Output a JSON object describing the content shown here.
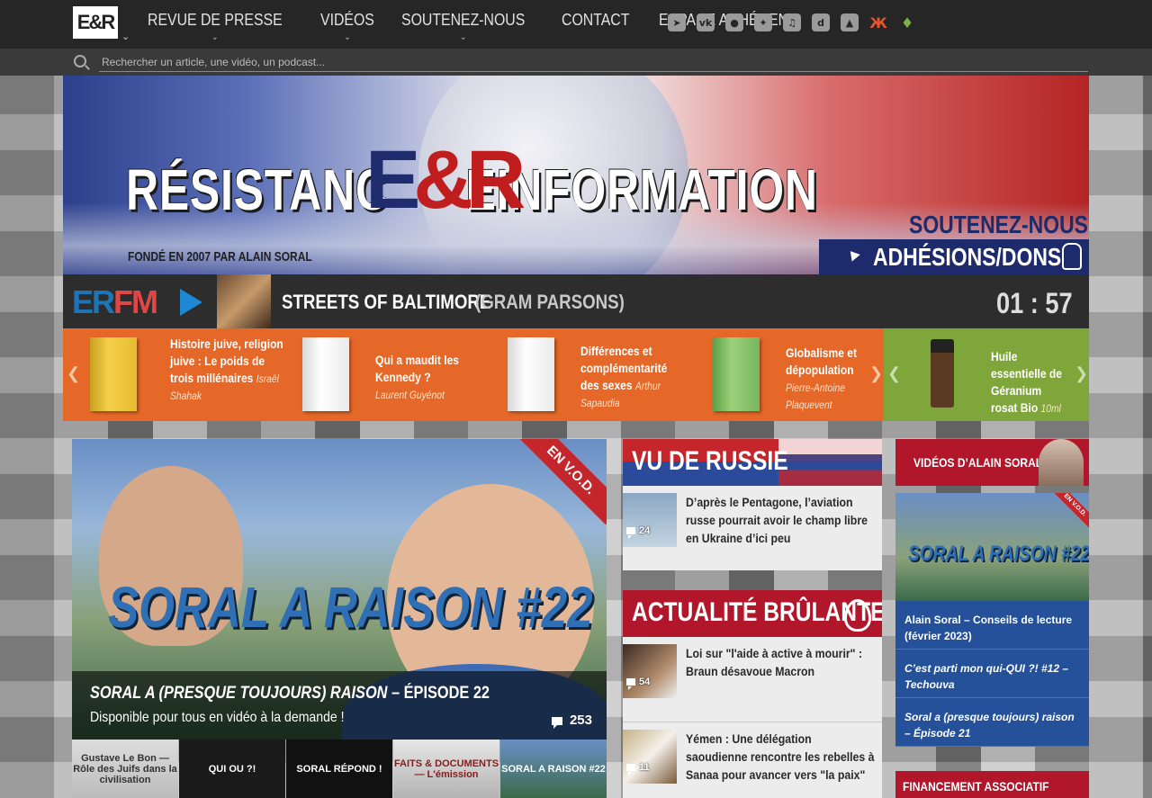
{
  "nav": {
    "logo": "E&R",
    "items": [
      {
        "label": "REVUE DE PRESSE",
        "has_dropdown": true
      },
      {
        "label": "VIDÉOS",
        "has_dropdown": true
      },
      {
        "label": "SOUTENEZ-NOUS",
        "has_dropdown": true
      },
      {
        "label": "CONTACT",
        "has_dropdown": false
      },
      {
        "label": "ESPACE ADHÉRENT",
        "has_dropdown": false
      }
    ],
    "socials": [
      "telegram-icon",
      "vk-icon",
      "odysee-icon",
      "gab-icon",
      "tiktok-icon",
      "dlive-icon",
      "brave-icon",
      "livejournal-icon",
      "rumble-icon"
    ]
  },
  "search": {
    "placeholder": "Rechercher un article, une vidéo, un podcast..."
  },
  "banner": {
    "title": "RÉSISTANC",
    "title_end": "EINFORMATION",
    "er": "E&R",
    "subtitle": "FONDÉ EN 2007 PAR ALAIN SORAL",
    "support": "SOUTENEZ-NOUS !",
    "donate": "ADHÉSIONS/DONS"
  },
  "radio": {
    "logo": "ERFM",
    "track": "STREETS OF BALTIMORE",
    "artist": "(GRAM PARSONS)",
    "time": "01 : 57"
  },
  "carousel": [
    {
      "title": "Histoire juive, religion juive : Le poids de trois millénaires",
      "author": "Israël Shahak"
    },
    {
      "title": "Qui a maudit les Kennedy ?",
      "author": "Laurent Guyénot"
    },
    {
      "title": "Différences et complémentarité des sexes",
      "author": "Arthur Sapaudia"
    },
    {
      "title": "Globalisme et dépopulation",
      "author": "Pierre-Antoine Plaquevent"
    },
    {
      "title": "Huile essentielle de Géranium rosat Bio",
      "author": "10ml"
    }
  ],
  "feature": {
    "ribbon": "EN V.O.D.",
    "logo_text": "SORAL A RAISON #22",
    "title_italic": "SORAL A (PRESQUE TOUJOURS) RAISON",
    "title_rest": " – ÉPISODE 22",
    "subtitle": "Disponible pour tous en vidéo à la demande !",
    "comments": "253"
  },
  "thumbs": [
    "Gustave Le Bon — Rôle des Juifs dans la civilisation",
    "QUI OU ?!",
    "SORAL RÉPOND !",
    "FAITS & DOCUMENTS — L'émission",
    "SORAL A RAISON #22"
  ],
  "russia": {
    "title": "VU DE RUSSIE",
    "items": [
      {
        "text": "D’après le Pentagone, l’aviation russe pourrait avoir le champ libre en Ukraine d’ici peu",
        "comments": "24"
      }
    ]
  },
  "hot": {
    "title": "ACTUALITÉ BRÛLANTE",
    "items": [
      {
        "text": "Loi sur \"l'aide à active à mourir\" : Braun désavoue Macron",
        "comments": "54"
      },
      {
        "text": "Yémen : Une délégation saoudienne rencontre les rebelles à Sanaa pour avancer vers \"la paix\"",
        "comments": "11"
      }
    ]
  },
  "right": {
    "title": "VIDÉOS D’ALAIN SORAL",
    "thumb_label": "SORAL A RAISON #22",
    "thumb_ribbon": "EN V.O.D.",
    "links": [
      {
        "text": "Alain Soral – Conseils de lecture (février 2023)",
        "italic": false
      },
      {
        "text": "C’est parti mon qui-QUI ?! #12 – Techouva",
        "italic": true
      },
      {
        "text": "Soral a (presque toujours) raison – Épisode 21",
        "italic": true
      }
    ],
    "financing": "FINANCEMENT ASSOCIATIF"
  }
}
